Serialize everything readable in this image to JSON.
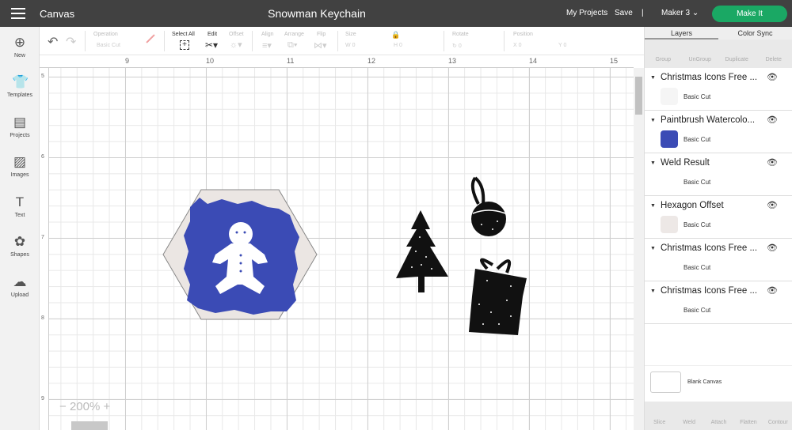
{
  "header": {
    "app": "Canvas",
    "title": "Snowman Keychain",
    "my_projects": "My Projects",
    "save": "Save",
    "divider": "|",
    "machine": "Maker 3",
    "make_it": "Make It"
  },
  "sidebar": [
    {
      "label": "New",
      "icon": "plus-icon"
    },
    {
      "label": "Templates",
      "icon": "shirt-icon"
    },
    {
      "label": "Projects",
      "icon": "projects-icon"
    },
    {
      "label": "Images",
      "icon": "image-icon"
    },
    {
      "label": "Text",
      "icon": "text-icon"
    },
    {
      "label": "Shapes",
      "icon": "shapes-icon"
    },
    {
      "label": "Upload",
      "icon": "upload-icon"
    }
  ],
  "toolbar": {
    "operation": "Operation",
    "operation_value": "Basic Cut",
    "select_all": "Select All",
    "edit": "Edit",
    "offset": "Offset",
    "align": "Align",
    "arrange": "Arrange",
    "flip": "Flip",
    "size": "Size",
    "w": "W",
    "h": "H",
    "rotate": "Rotate",
    "position": "Position",
    "x": "X",
    "y": "Y",
    "zero": "0"
  },
  "ruler": {
    "x": [
      "9",
      "10",
      "11",
      "12",
      "13",
      "14",
      "15"
    ],
    "y": [
      "5",
      "6",
      "7",
      "8",
      "9"
    ]
  },
  "zoom": {
    "minus": "−",
    "value": "200%",
    "plus": "+"
  },
  "panel": {
    "tabs": [
      "Layers",
      "Color Sync"
    ],
    "actions": [
      "Group",
      "UnGroup",
      "Duplicate",
      "Delete"
    ],
    "layers": [
      {
        "name": "Christmas Icons Free ...",
        "op": "Basic Cut",
        "color": "#f5f5f5"
      },
      {
        "name": "Paintbrush Watercolo...",
        "op": "Basic Cut",
        "color": "#3b4bb5"
      },
      {
        "name": "Weld Result",
        "op": "Basic Cut",
        "color": "#ffffff"
      },
      {
        "name": "Hexagon Offset",
        "op": "Basic Cut",
        "color": "#ede8e6"
      },
      {
        "name": "Christmas Icons Free ...",
        "op": "Basic Cut",
        "color": "#ffffff"
      },
      {
        "name": "Christmas Icons Free ...",
        "op": "Basic Cut",
        "color": "#ffffff"
      }
    ],
    "blank": "Blank Canvas",
    "bottom": [
      "Slice",
      "Weld",
      "Attach",
      "Flatten",
      "Contour"
    ]
  },
  "colors": {
    "topbar": "#414141",
    "make_it": "#1aa864",
    "blue": "#3b4bb5",
    "hexagon": "#ebe6e3"
  }
}
